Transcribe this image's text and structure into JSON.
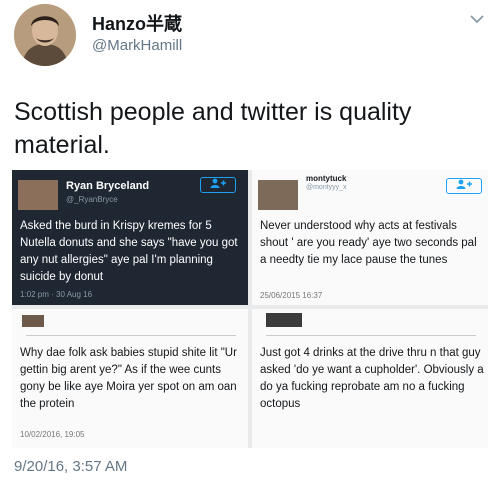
{
  "author": {
    "display_name": "Hanzo半蔵",
    "handle": "@MarkHamill",
    "avatar_icon": "avatar-image",
    "menu_icon": "chevron-down-icon"
  },
  "tweet": {
    "text": "Scottish people and twitter is quality material.",
    "timestamp": "9/20/16, 3:57 AM"
  },
  "embedded_tweets": [
    {
      "name": "Ryan Bryceland",
      "handle": "@_RyanBryce",
      "text": "Asked the burd in Krispy kremes for 5 Nutella donuts and she says \"have you got any nut allergies\" aye pal I'm planning suicide by donut",
      "time": "1:02 pm · 30 Aug 16",
      "follow_icon": "follow-user-icon"
    },
    {
      "name": "montytuck",
      "handle": "@montyyy_x",
      "text": "Never understood why acts at festivals shout ' are you ready' aye two seconds pal a needty tie my lace pause the tunes",
      "time": "25/06/2015 16:37",
      "follow_icon": "follow-user-icon"
    },
    {
      "name": "",
      "handle": "",
      "text": "Why dae folk ask babies stupid shite lit \"Ur gettin big arent ye?\" As if the wee cunts gony be like aye Moira yer spot on am oan the protein",
      "time": "10/02/2016, 19:05"
    },
    {
      "name": "",
      "handle": "",
      "text": "Just got 4 drinks at the drive thru n that guy asked 'do ye want a cupholder'. Obviously a do ya fucking reprobate am no a fucking octopus",
      "time": ""
    }
  ],
  "colors": {
    "link_blue": "#1da1f2",
    "dark_card": "#1f2733",
    "secondary_text": "#657786"
  }
}
